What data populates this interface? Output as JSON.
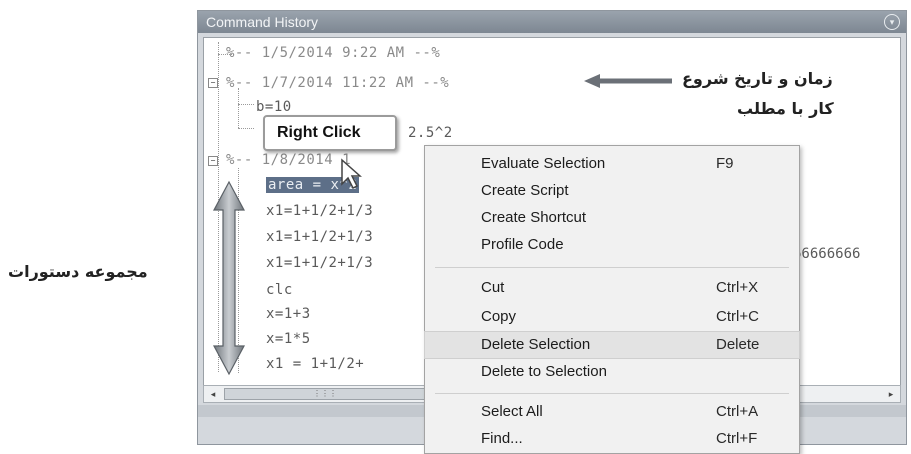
{
  "window": {
    "title": "Command History"
  },
  "history": {
    "lines": [
      {
        "text": "%-- 1/5/2014 9:22 AM --%",
        "type": "session"
      },
      {
        "text": "%-- 1/7/2014 11:22 AM --%",
        "type": "session"
      },
      {
        "text": "b=10",
        "type": "cmd"
      },
      {
        "text": "2.5^2",
        "type": "cmd"
      },
      {
        "text": "%-- 1/8/2014 1",
        "type": "session"
      },
      {
        "text": "area = x^2",
        "type": "cmd"
      },
      {
        "text": "x1=1+1/2+1/3",
        "type": "cmd"
      },
      {
        "text": "x1=1+1/2+1/3",
        "type": "cmd"
      },
      {
        "text": "x1=1+1/2+1/3",
        "type": "cmd"
      },
      {
        "text": "clc",
        "type": "cmd"
      },
      {
        "text": "x=1+3",
        "type": "cmd"
      },
      {
        "text": "x=1*5",
        "type": "cmd"
      },
      {
        "text": "x1 = 1+1/2+",
        "type": "cmd"
      }
    ],
    "result_fragment": "66666666"
  },
  "tooltip": {
    "label": "Right Click"
  },
  "context_menu": {
    "items": [
      {
        "label": "Evaluate Selection",
        "shortcut": "F9"
      },
      {
        "label": "Create Script",
        "shortcut": ""
      },
      {
        "label": "Create Shortcut",
        "shortcut": ""
      },
      {
        "label": "Profile Code",
        "shortcut": ""
      },
      {
        "label": "Cut",
        "shortcut": "Ctrl+X"
      },
      {
        "label": "Copy",
        "shortcut": "Ctrl+C"
      },
      {
        "label": "Delete Selection",
        "shortcut": "Delete",
        "highlighted": true
      },
      {
        "label": "Delete to Selection",
        "shortcut": ""
      },
      {
        "label": "Select All",
        "shortcut": "Ctrl+A"
      },
      {
        "label": "Find...",
        "shortcut": "Ctrl+F"
      }
    ]
  },
  "annotations": {
    "start_time_line1": "زمان و تاریخ شروع",
    "start_time_line2": "کار با مطلب",
    "commands": "مجموعه دستورات"
  },
  "icons": [
    "expand-icon",
    "collapse-icon",
    "scroll-left-icon",
    "scroll-right-icon",
    "mouse-cursor-icon",
    "arrow-left-icon",
    "double-arrow-icon",
    "window-menu-icon"
  ]
}
